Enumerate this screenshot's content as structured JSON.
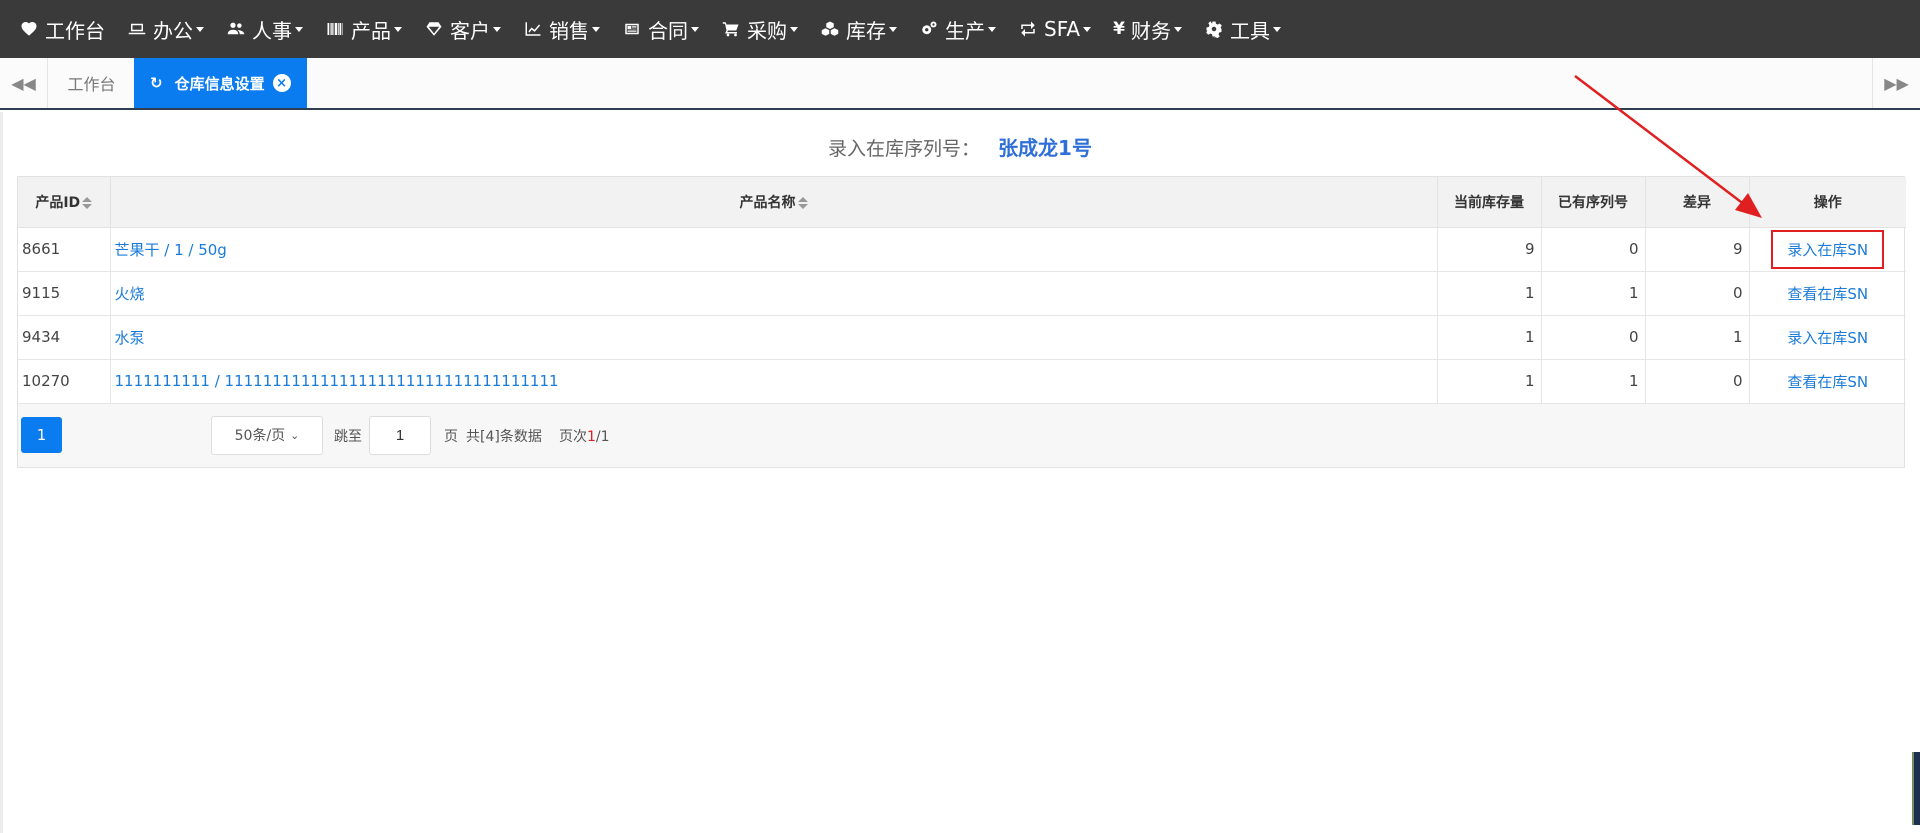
{
  "nav": [
    {
      "label": "工作台",
      "icon": "heart-icon",
      "caret": false
    },
    {
      "label": "办公",
      "icon": "laptop-icon",
      "caret": true
    },
    {
      "label": "人事",
      "icon": "users-icon",
      "caret": true
    },
    {
      "label": "产品",
      "icon": "barcode-icon",
      "caret": true
    },
    {
      "label": "客户",
      "icon": "diamond-icon",
      "caret": true
    },
    {
      "label": "销售",
      "icon": "line-chart-icon",
      "caret": true
    },
    {
      "label": "合同",
      "icon": "newspaper-icon",
      "caret": true
    },
    {
      "label": "采购",
      "icon": "cart-icon",
      "caret": true
    },
    {
      "label": "库存",
      "icon": "cubes-icon",
      "caret": true
    },
    {
      "label": "生产",
      "icon": "cogs-icon",
      "caret": true
    },
    {
      "label": "SFA",
      "icon": "retweet-icon",
      "caret": true
    },
    {
      "label": "财务",
      "icon": "yen-icon",
      "caret": true
    },
    {
      "label": "工具",
      "icon": "gear-icon",
      "caret": true
    }
  ],
  "tabs": {
    "home": "工作台",
    "active": "仓库信息设置"
  },
  "title": {
    "label": "录入在库序列号：",
    "value": "张成龙1号"
  },
  "table": {
    "headers": {
      "id": "产品ID",
      "name": "产品名称",
      "stock": "当前库存量",
      "serials": "已有序列号",
      "diff": "差异",
      "op": "操作"
    },
    "rows": [
      {
        "id": "8661",
        "name": "芒果干 / 1 / 50g",
        "stock": "9",
        "serials": "0",
        "diff": "9",
        "op": "录入在库SN"
      },
      {
        "id": "9115",
        "name": "火烧",
        "stock": "1",
        "serials": "1",
        "diff": "0",
        "op": "查看在库SN"
      },
      {
        "id": "9434",
        "name": "水泵",
        "stock": "1",
        "serials": "0",
        "diff": "1",
        "op": "录入在库SN"
      },
      {
        "id": "10270",
        "name": "1111111111 / 11111111111111111111111111111111111",
        "stock": "1",
        "serials": "1",
        "diff": "0",
        "op": "查看在库SN"
      }
    ]
  },
  "pager": {
    "current": "1",
    "page_size": "50条/页",
    "jump_label": "跳至",
    "jump_value": "1",
    "page_label": "页",
    "total": "共[4]条数据",
    "count_label": "页次",
    "count_current": "1",
    "count_total": "/1"
  },
  "colors": {
    "nav_bg": "#3a3a3a",
    "accent": "#0a7cf0",
    "link": "#1a7bd8",
    "highlight": "#e02020"
  }
}
